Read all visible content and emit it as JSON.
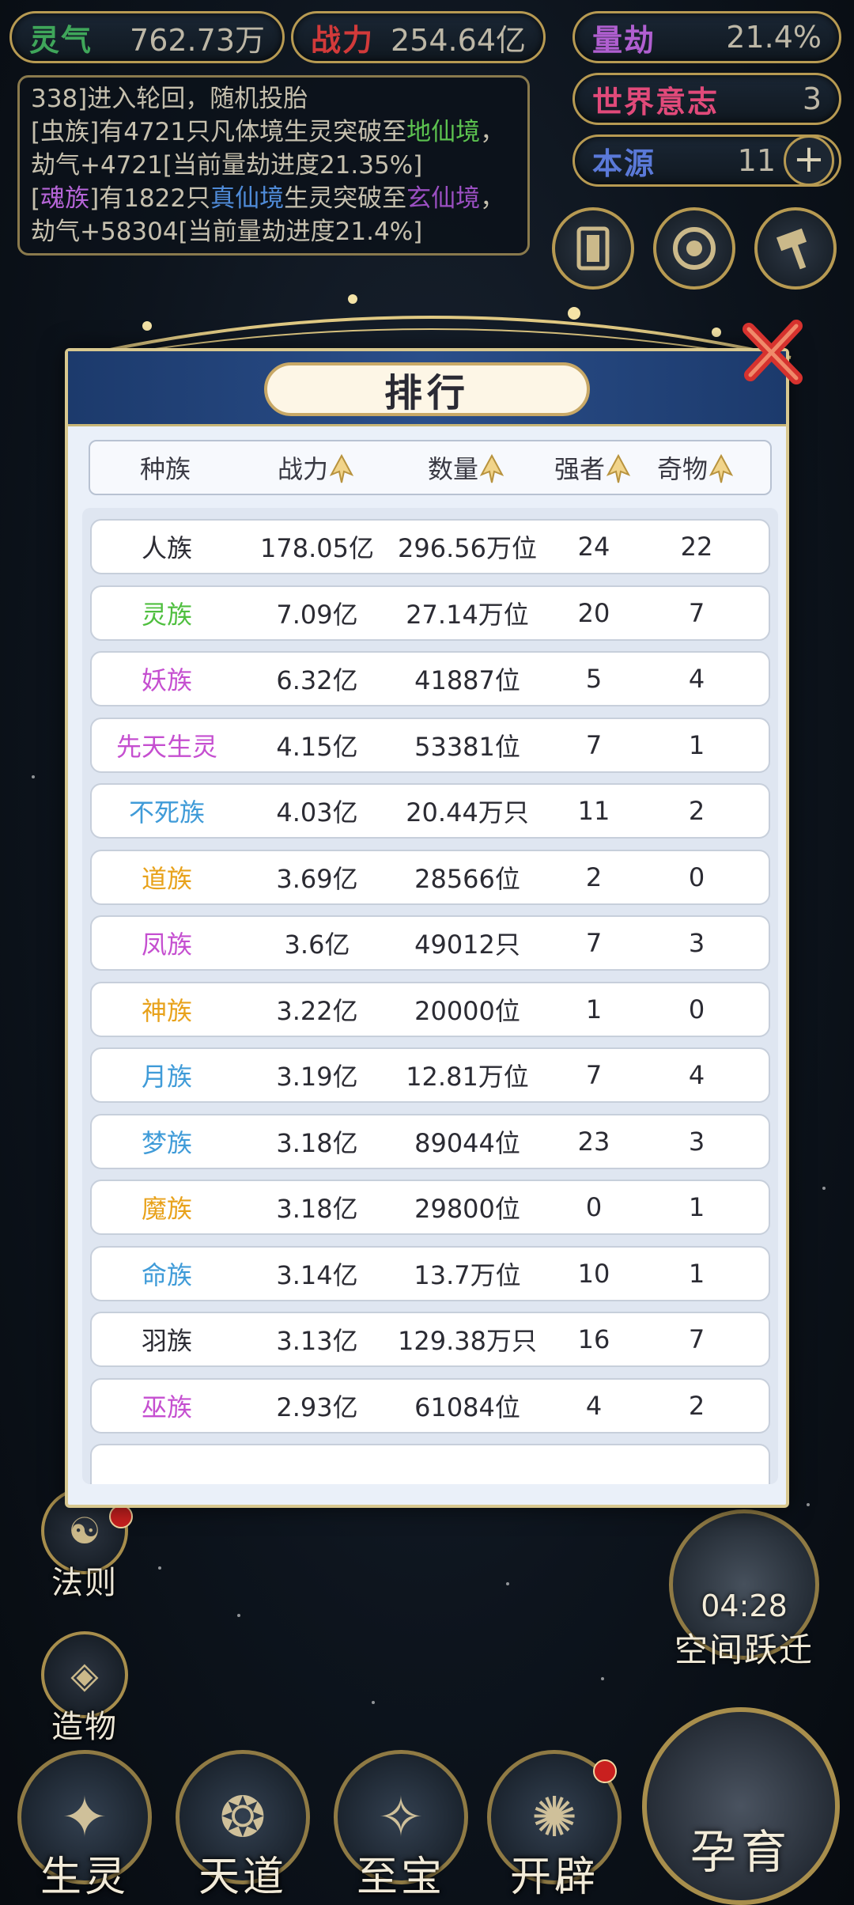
{
  "top_bar": {
    "lingqi": {
      "label": "灵气",
      "value": "762.73万"
    },
    "zhanli": {
      "label": "战力",
      "value": "254.64亿"
    },
    "liangjie": {
      "label": "量劫",
      "value": "21.4%"
    },
    "world_will": {
      "label": "世界意志",
      "value": "3"
    },
    "origin": {
      "label": "本源",
      "value": "11",
      "plus": "+"
    }
  },
  "log": {
    "line1": "338]进入轮回，随机投胎",
    "entry2": {
      "a": "[虫族]有4721只凡体境生灵突破至",
      "b": "地仙境",
      "c": "，劫气+4721[当前量劫进度21.35%]"
    },
    "entry3": {
      "a": "[",
      "b": "魂族",
      "c": "]有1822只",
      "d": "真仙境",
      "e": "生灵突破至",
      "f": "玄仙境",
      "g": "，劫气+58304[当前量劫进度21.4%]"
    }
  },
  "side_left": [
    {
      "label": "法则"
    },
    {
      "label": "造物"
    }
  ],
  "side_right": {
    "timer": "04:28",
    "label": "空间跃迁"
  },
  "bottom_nav": [
    {
      "label": "生灵"
    },
    {
      "label": "天道"
    },
    {
      "label": "至宝"
    },
    {
      "label": "开辟"
    }
  ],
  "main_button": {
    "label": "孕育"
  },
  "modal": {
    "title": "排行",
    "headers": [
      "种族",
      "战力",
      "数量",
      "强者",
      "奇物"
    ],
    "rows": [
      {
        "race": "人族",
        "power": "178.05亿",
        "count": "296.56万位",
        "strong": "24",
        "items": "22",
        "color": "#2b2b33"
      },
      {
        "race": "灵族",
        "power": "7.09亿",
        "count": "27.14万位",
        "strong": "20",
        "items": "7",
        "color": "#4fbf3f"
      },
      {
        "race": "妖族",
        "power": "6.32亿",
        "count": "41887位",
        "strong": "5",
        "items": "4",
        "color": "#c54fd0"
      },
      {
        "race": "先天生灵",
        "power": "4.15亿",
        "count": "53381位",
        "strong": "7",
        "items": "1",
        "color": "#c54fd0"
      },
      {
        "race": "不死族",
        "power": "4.03亿",
        "count": "20.44万只",
        "strong": "11",
        "items": "2",
        "color": "#3f9bd8"
      },
      {
        "race": "道族",
        "power": "3.69亿",
        "count": "28566位",
        "strong": "2",
        "items": "0",
        "color": "#e8a21b"
      },
      {
        "race": "凤族",
        "power": "3.6亿",
        "count": "49012只",
        "strong": "7",
        "items": "3",
        "color": "#c54fd0"
      },
      {
        "race": "神族",
        "power": "3.22亿",
        "count": "20000位",
        "strong": "1",
        "items": "0",
        "color": "#e8a21b"
      },
      {
        "race": "月族",
        "power": "3.19亿",
        "count": "12.81万位",
        "strong": "7",
        "items": "4",
        "color": "#3f9bd8"
      },
      {
        "race": "梦族",
        "power": "3.18亿",
        "count": "89044位",
        "strong": "23",
        "items": "3",
        "color": "#3f9bd8"
      },
      {
        "race": "魔族",
        "power": "3.18亿",
        "count": "29800位",
        "strong": "0",
        "items": "1",
        "color": "#e8a21b"
      },
      {
        "race": "命族",
        "power": "3.14亿",
        "count": "13.7万位",
        "strong": "10",
        "items": "1",
        "color": "#3f9bd8"
      },
      {
        "race": "羽族",
        "power": "3.13亿",
        "count": "129.38万只",
        "strong": "16",
        "items": "7",
        "color": "#2b2b33"
      },
      {
        "race": "巫族",
        "power": "2.93亿",
        "count": "61084位",
        "strong": "4",
        "items": "2",
        "color": "#c54fd0"
      }
    ]
  }
}
